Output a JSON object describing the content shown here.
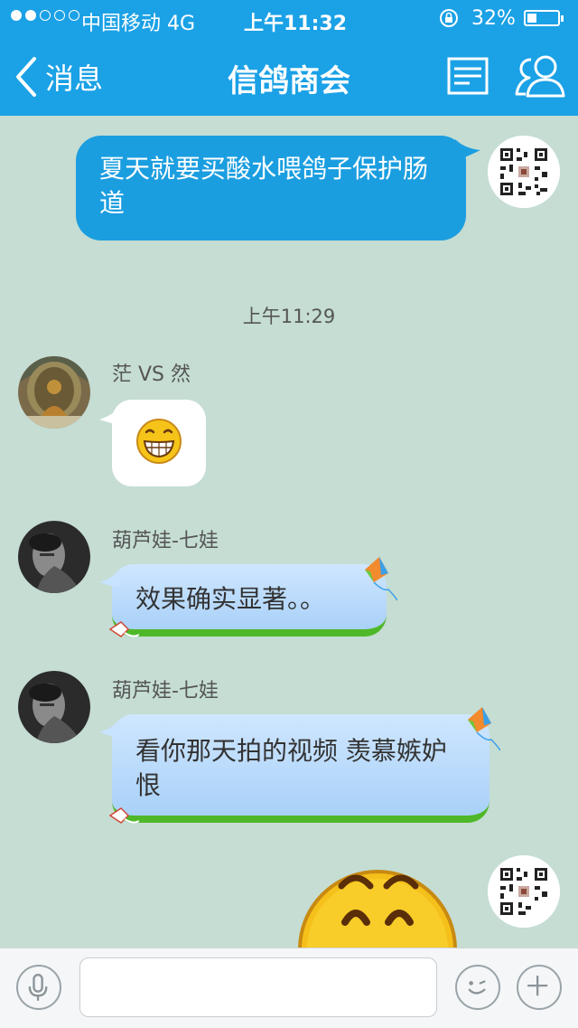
{
  "status_bar": {
    "signal_dots_filled": 2,
    "signal_dots_total": 5,
    "carrier": "中国移动 4G",
    "time": "上午11:32",
    "battery_percent": "32%",
    "battery_level": 0.32,
    "rotation_lock_icon": "rotation-lock-icon"
  },
  "nav": {
    "back_label": "消息",
    "title": "信鸽商会",
    "back_icon": "chevron-left-icon",
    "list_icon": "list-icon",
    "members_icon": "group-members-icon"
  },
  "messages": [
    {
      "direction": "out",
      "type": "text",
      "text": "夏天就要买酸水喂鸽子保护肠道",
      "avatar": "qr-code-avatar"
    },
    {
      "type": "timestamp",
      "text": "上午11:29"
    },
    {
      "direction": "in",
      "sender": "茫 VS 然",
      "type": "emoji",
      "emoji": "grin-emoji"
    },
    {
      "direction": "in",
      "sender": "葫芦娃-七娃",
      "type": "text",
      "text": "效果确实显著。。"
    },
    {
      "direction": "in",
      "sender": "葫芦娃-七娃",
      "type": "text",
      "text": "看你那天拍的视频  羡慕嫉妒恨"
    },
    {
      "direction": "out",
      "type": "emoji",
      "emoji": "smile-emoji",
      "avatar": "qr-code-avatar"
    }
  ],
  "input_bar": {
    "voice_icon": "microphone-icon",
    "text_value": "",
    "emoji_icon": "emoji-icon",
    "plus_icon": "plus-icon"
  },
  "colors": {
    "header_blue": "#1ba1e6",
    "chat_background": "#c5ddd3",
    "outgoing_bubble": "#1b9ee0",
    "incoming_bubble": "#b9dcfb",
    "grass_green": "#4fb828"
  }
}
